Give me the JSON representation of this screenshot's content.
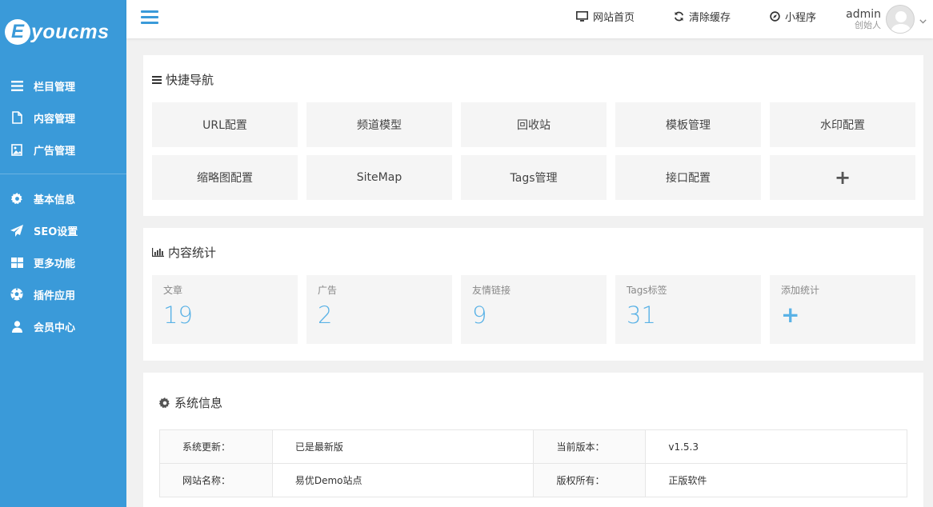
{
  "brand": {
    "logo_letter": "E",
    "logo_text": "youcms",
    "accent_color": "#3a9ad9"
  },
  "sidebar": {
    "group1": [
      {
        "label": "栏目管理",
        "icon": "list-icon"
      },
      {
        "label": "内容管理",
        "icon": "document-icon"
      },
      {
        "label": "广告管理",
        "icon": "image-icon"
      }
    ],
    "group2": [
      {
        "label": "基本信息",
        "icon": "gear-icon"
      },
      {
        "label": "SEO设置",
        "icon": "paper-plane-icon"
      },
      {
        "label": "更多功能",
        "icon": "grid-icon"
      },
      {
        "label": "插件应用",
        "icon": "soccer-ball-icon"
      },
      {
        "label": "会员中心",
        "icon": "user-icon"
      }
    ]
  },
  "topbar": {
    "home_label": "网站首页",
    "clear_cache_label": "清除缓存",
    "mini_program_label": "小程序",
    "user_name": "admin",
    "user_role": "创始人"
  },
  "quick_nav": {
    "title": "快捷导航",
    "items": [
      "URL配置",
      "频道模型",
      "回收站",
      "模板管理",
      "水印配置",
      "缩略图配置",
      "SiteMap",
      "Tags管理",
      "接口配置",
      "+"
    ]
  },
  "content_stats": {
    "title": "内容统计",
    "items": [
      {
        "label": "文章",
        "value": "19"
      },
      {
        "label": "广告",
        "value": "2"
      },
      {
        "label": "友情链接",
        "value": "9"
      },
      {
        "label": "Tags标签",
        "value": "31"
      },
      {
        "label": "添加统计",
        "value": "+"
      }
    ]
  },
  "system_info": {
    "title": "系统信息",
    "rows": [
      [
        "系统更新：",
        "已是最新版",
        "当前版本：",
        "v1.5.3"
      ],
      [
        "网站名称：",
        "易优Demo站点",
        "版权所有：",
        "正版软件"
      ]
    ]
  }
}
